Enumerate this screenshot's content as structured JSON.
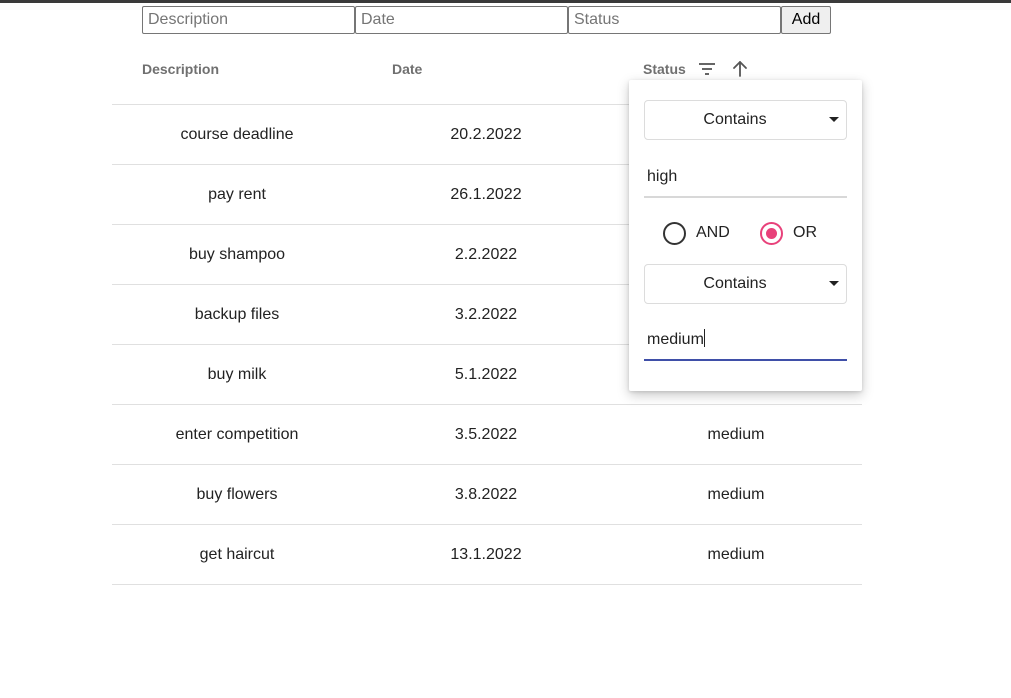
{
  "form": {
    "description_placeholder": "Description",
    "date_placeholder": "Date",
    "status_placeholder": "Status",
    "add_label": "Add"
  },
  "table": {
    "headers": {
      "description": "Description",
      "date": "Date",
      "status": "Status"
    },
    "rows": [
      {
        "description": "course deadline",
        "date": "20.2.2022",
        "status": ""
      },
      {
        "description": "pay rent",
        "date": "26.1.2022",
        "status": ""
      },
      {
        "description": "buy shampoo",
        "date": "2.2.2022",
        "status": ""
      },
      {
        "description": "backup files",
        "date": "3.2.2022",
        "status": ""
      },
      {
        "description": "buy milk",
        "date": "5.1.2022",
        "status": ""
      },
      {
        "description": "enter competition",
        "date": "3.5.2022",
        "status": "medium"
      },
      {
        "description": "buy flowers",
        "date": "3.8.2022",
        "status": "medium"
      },
      {
        "description": "get haircut",
        "date": "13.1.2022",
        "status": "medium"
      }
    ]
  },
  "filter": {
    "condition1": "Contains",
    "value1": "high",
    "operator_and": "AND",
    "operator_or": "OR",
    "selected_operator": "OR",
    "condition2": "Contains",
    "value2": "medium"
  },
  "icons": {
    "filter": "filter-icon",
    "sort": "arrow-up-icon"
  },
  "colors": {
    "radio_selected": "#e8417a",
    "input_focus": "#3f4fa8"
  }
}
